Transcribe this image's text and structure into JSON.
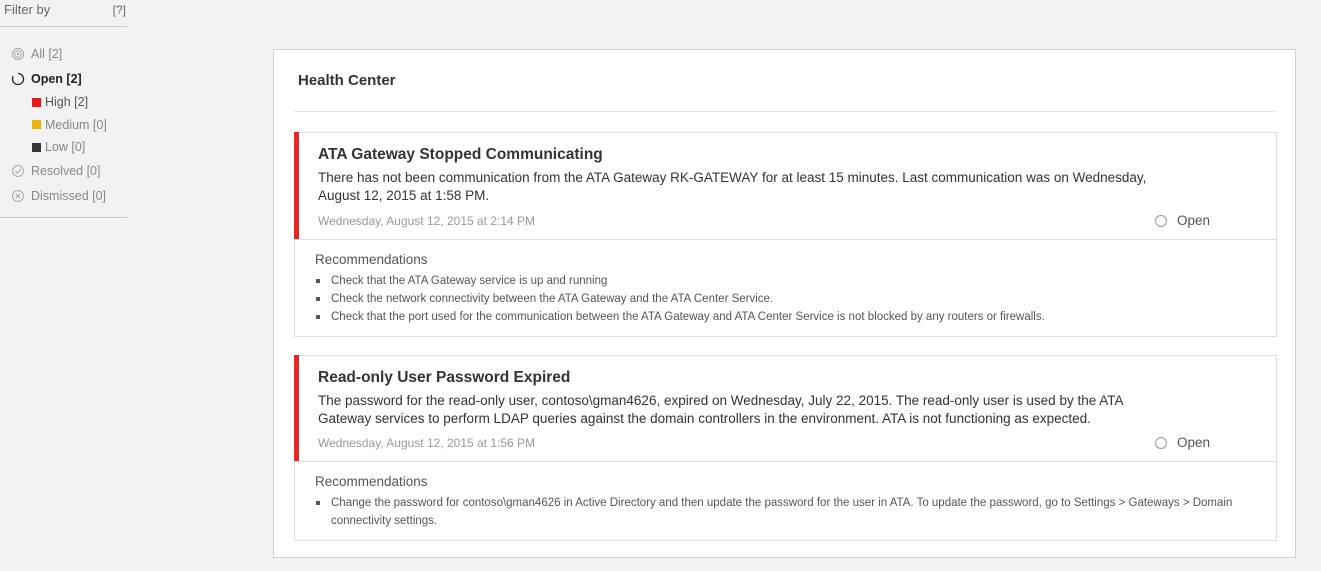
{
  "sidebar": {
    "title": "Filter by",
    "help": "[?]",
    "items": [
      {
        "label": "All [2]"
      },
      {
        "label": "Open [2]"
      },
      {
        "label": "High [2]"
      },
      {
        "label": "Medium [0]"
      },
      {
        "label": "Low [0]"
      },
      {
        "label": "Resolved [0]"
      },
      {
        "label": "Dismissed [0]"
      }
    ]
  },
  "panel": {
    "title": "Health Center"
  },
  "alerts": [
    {
      "title": "ATA Gateway Stopped Communicating",
      "description": "There has not been communication from the ATA Gateway RK-GATEWAY for at least 15 minutes. Last communication was on Wednesday, August 12, 2015 at 1:58 PM.",
      "time": "Wednesday, August 12, 2015 at 2:14 PM",
      "status": "Open",
      "recommendations_title": "Recommendations",
      "recommendations": [
        "Check that the ATA Gateway service is up and running",
        "Check the network connectivity between the ATA Gateway and the ATA Center Service.",
        "Check that the port used for the communication between the ATA Gateway and ATA Center Service is not blocked by any routers or firewalls."
      ]
    },
    {
      "title": "Read-only User Password Expired",
      "description": "The password for the read-only user, contoso\\gman4626, expired on Wednesday, July 22, 2015. The read-only user is used by the ATA Gateway services to perform LDAP queries against the domain controllers in the environment. ATA is not functioning as expected.",
      "time": "Wednesday, August 12, 2015 at 1:56 PM",
      "status": "Open",
      "recommendations_title": "Recommendations",
      "recommendations": [
        "Change the password for contoso\\gman4626 in Active Directory and then update the password for the user in ATA. To update the password, go to Settings > Gateways > Domain connectivity settings."
      ]
    }
  ],
  "colors": {
    "severity_high": "#e81c1c",
    "severity_medium": "#e8b40e",
    "severity_low": "#333333",
    "alert_bar": "#e32626"
  }
}
